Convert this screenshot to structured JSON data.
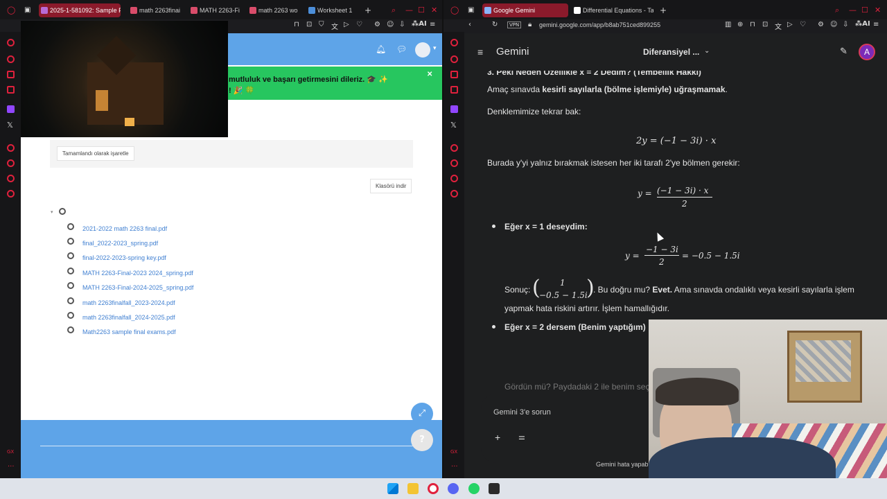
{
  "left_window": {
    "tabs": [
      {
        "label": "2025-1-581092: Sample Fi",
        "active": true
      },
      {
        "label": "math 2263finai"
      },
      {
        "label": "MATH 2263-Fi"
      },
      {
        "label": "math 2263 wo"
      },
      {
        "label": "Worksheet 1"
      }
    ],
    "banner_line1": "mutluluk ve başarı getirmesini dileriz. 🎓 ✨",
    "banner_line2": "! 🎉 🍀",
    "mark_done_label": "Tamamlandı olarak işaretle",
    "download_folder_label": "Klasörü indir",
    "files": [
      "2021-2022 math 2263 final.pdf",
      "final_2022-2023_spring.pdf",
      "final-2022-2023-spring key.pdf",
      "MATH 2263-Final-2023 2024_spring.pdf",
      "MATH 2263-Final-2024-2025_spring.pdf",
      "math 2263finalfall_2023-2024.pdf",
      "math 2263finalfall_2024-2025.pdf",
      "Math2263 sample final exams.pdf"
    ]
  },
  "right_window": {
    "tabs": [
      {
        "label": "Google Gemini",
        "active": true
      },
      {
        "label": "Differential Equations - Ta"
      }
    ],
    "url": "gemini.google.com/app/b8ab751ced899255",
    "app_title": "Gemini",
    "conversation_title": "Diferansiyel ...",
    "avatar_letter": "A",
    "content": {
      "heading_partial": "3. Peki Neden Özellikle x = 2 Dedim? (Tembellik Hakkı)",
      "p1_prefix": "Amaç sınavda ",
      "p1_bold": "kesirli sayılarla (bölme işlemiyle) uğraşmamak",
      "p1_suffix": ".",
      "p2": "Denklemimize tekrar bak:",
      "eq1": "2y = (−1 − 3i) · x",
      "p3": "Burada y'yi yalnız bırakmak istesen her iki tarafı 2'ye bölmen gerekir:",
      "eq2_lhs": "y =",
      "eq2_num": "(−1 − 3i) · x",
      "eq2_den": "2",
      "bullet1": "Eğer x = 1 deseydim:",
      "eq3_lhs": "y =",
      "eq3_num": "−1 − 3i",
      "eq3_den": "2",
      "eq3_rhs": "= −0.5 − 1.5i",
      "sonuc_label": "Sonuç:",
      "vec_top": "1",
      "vec_bottom": "−0.5 − 1.5i",
      "sonuc_text_a": ". Bu doğru mu? ",
      "sonuc_bold": "Evet.",
      "sonuc_text_b": " Ama sınavda ondalıklı veya kesirli sayılarla işlem",
      "sonuc_line2": "yapmak hata riskini artırır. İşlem hamallığıdır.",
      "bullet2": "Eğer x = 2 dersem (Benim yaptığım)",
      "partial_line": "Gördün mü? Paydadaki 2 ile benim seç"
    },
    "input_placeholder": "Gemini 3'e sorun",
    "footer_note": "Gemini hata yapab"
  }
}
